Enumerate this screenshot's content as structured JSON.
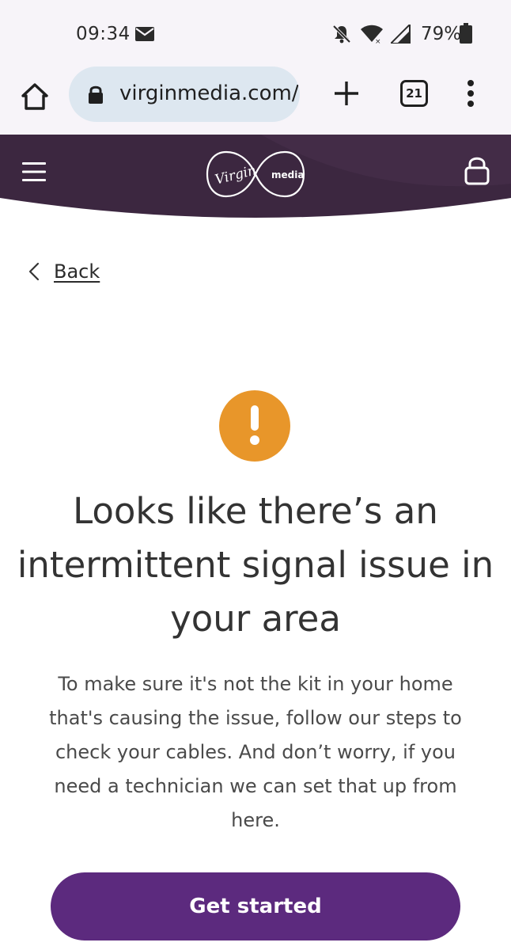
{
  "status_bar": {
    "time": "09:34",
    "battery": "79%",
    "icons": [
      "mail-icon",
      "notifications-muted-icon",
      "wifi-icon",
      "cell-signal-icon",
      "battery-icon"
    ]
  },
  "browser": {
    "url": "virginmedia.com/",
    "tab_count": "21",
    "icons": [
      "home-icon",
      "lock-icon",
      "plus-icon",
      "more-vert-icon"
    ]
  },
  "header": {
    "logo_virgin": "Virgin",
    "logo_media": "media",
    "icons": [
      "hamburger-menu-icon",
      "padlock-icon"
    ]
  },
  "nav": {
    "back_label": "Back"
  },
  "alert": {
    "icon": "exclamation-icon",
    "color": "#e8962a"
  },
  "content": {
    "headline": "Looks like there’s an intermittent signal issue in your area",
    "body": "To make sure it's not the kit in your home that's causing the issue, follow our steps to check your cables. And don’t worry, if you need a technician we can set that up from here."
  },
  "cta": {
    "label": "Get started",
    "color": "#5c2a7e"
  },
  "colors": {
    "header_bg": "#3c2740",
    "chrome_bg": "#f7f4f9",
    "url_pill": "#dde7f0"
  }
}
